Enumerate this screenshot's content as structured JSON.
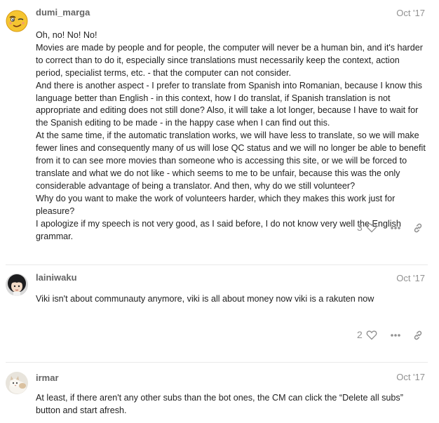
{
  "posts": [
    {
      "username": "dumi_marga",
      "date": "Oct '17",
      "avatar_icon": "winking-face-avatar",
      "paragraphs": [
        "Oh, no! No! No!",
        "Movies are made by people and for people, the computer will never be a human bin, and it's harder to correct than to do it, especially since translations must necessarily keep the context, action period, specialist terms, etc. - that the computer can not consider.",
        "And there is another aspect - I prefer to translate from Spanish into Romanian, because I know this language better than English - in this context, how I do translat, if Spanish translation is not appropriate and editing does not still done? Also, it will take a lot longer, because I have to wait for the Spanish editing to be made - in the happy case when I can find out this.",
        "At the same time, if the automatic translation works, we will have less to translate, so we will make fewer lines and consequently many of us will lose QC status and we will no longer be able to benefit from it to can see more movies than someone who is accessing this site, or we will be forced to translate and what we do not like - which seems to me to be unfair, because this was the only considerable advantage of being a translator. And then, why do we still volunteer?",
        "Why do you want to make the work of volunteers harder, which they makes this work just for pleasure?",
        "I apologize if my speech is not very good, as I said before, I do not know very well the English grammar."
      ],
      "likes": "3"
    },
    {
      "username": "lainiwaku",
      "date": "Oct '17",
      "avatar_icon": "anime-girl-avatar",
      "paragraphs": [
        "Viki isn't about communauty anymore, viki is all about money now viki is a rakuten now"
      ],
      "likes": "2"
    },
    {
      "username": "irmar",
      "date": "Oct '17",
      "avatar_icon": "cat-avatar",
      "paragraphs": [
        "At least, if there aren't any other subs than the bot ones, the CM can click the “Delete all subs” button and start afresh."
      ]
    }
  ],
  "icons": {
    "like": "heart-outline-icon",
    "more": "ellipsis-icon",
    "share": "link-icon"
  },
  "colors": {
    "username": "#646464",
    "meta": "#919191",
    "text": "#222222",
    "divider": "#e9e9e9"
  }
}
